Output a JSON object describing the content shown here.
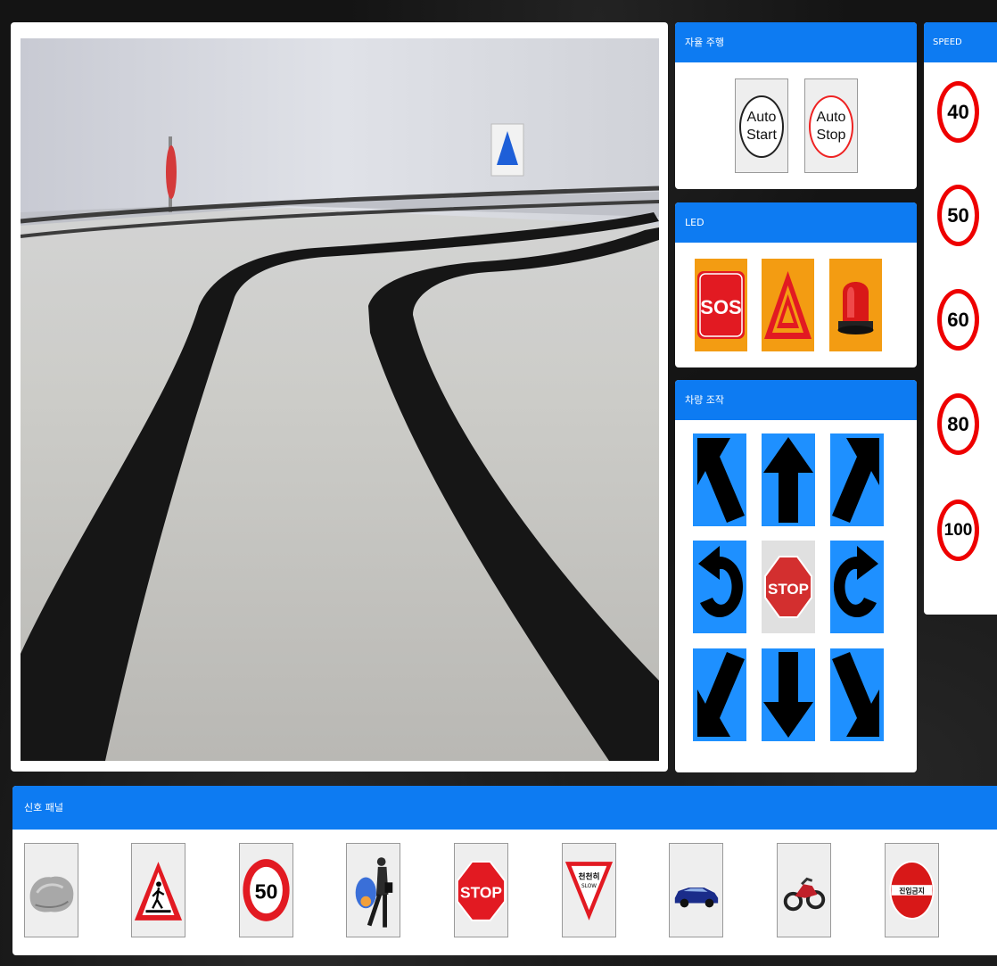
{
  "camera": {
    "label": ""
  },
  "auto_panel": {
    "title": "자율 주행",
    "start": {
      "line1": "Auto",
      "line2": "Start"
    },
    "stop": {
      "line1": "Auto",
      "line2": "Stop"
    }
  },
  "led_panel": {
    "title": "LED",
    "items": [
      {
        "icon": "sos-icon",
        "text": "SOS"
      },
      {
        "icon": "warning-triangle-icon"
      },
      {
        "icon": "red-beacon-icon"
      }
    ]
  },
  "drive_panel": {
    "title": "차량 조작",
    "buttons": [
      "arrow-up-left-icon",
      "arrow-up-icon",
      "arrow-up-right-icon",
      "rotate-left-icon",
      "stop-sign-icon",
      "rotate-right-icon",
      "arrow-down-left-icon",
      "arrow-down-icon",
      "arrow-down-right-icon"
    ],
    "stop_text": "STOP"
  },
  "speed_panel": {
    "title": "SPEED",
    "values": [
      "40",
      "50",
      "60",
      "80",
      "100"
    ]
  },
  "signal_panel": {
    "title": "신호 패널",
    "items": [
      {
        "icon": "rock-icon"
      },
      {
        "icon": "pedestrian-crossing-icon"
      },
      {
        "icon": "speed-limit-50-icon",
        "text": "50"
      },
      {
        "icon": "walking-person-icon"
      },
      {
        "icon": "stop-sign-icon",
        "text": "STOP"
      },
      {
        "icon": "yield-sign-icon",
        "text": "천천히",
        "subtext": "SLOW"
      },
      {
        "icon": "car-icon"
      },
      {
        "icon": "motorcycle-icon"
      },
      {
        "icon": "no-entry-icon",
        "text": "진입금지"
      }
    ]
  },
  "colors": {
    "accent": "#0d7bf2",
    "arrow_bg": "#1e90ff",
    "led_bg": "#f39c12",
    "sign_red": "#e00"
  }
}
